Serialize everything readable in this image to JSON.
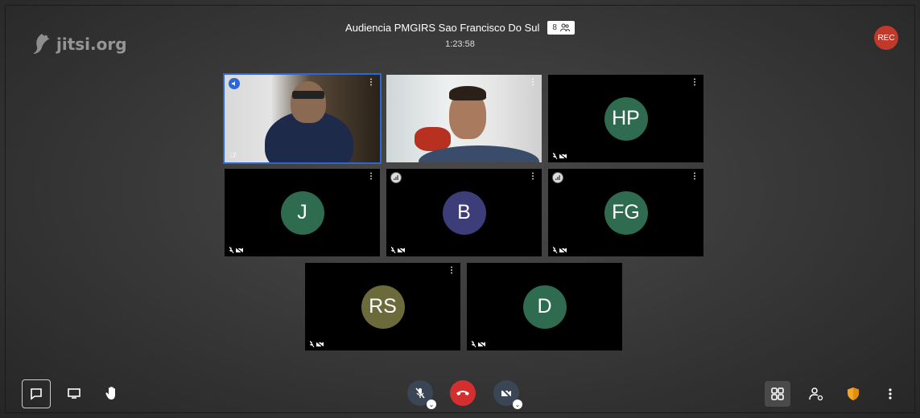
{
  "logo": {
    "text": "jitsi.org"
  },
  "header": {
    "title": "Audiencia PMGIRS Sao Francisco Do Sul",
    "participant_count": "8",
    "duration": "1:23:58"
  },
  "recording": {
    "label": "REC",
    "color": "#c0392b"
  },
  "tiles": [
    {
      "type": "video",
      "name": "speaker-video",
      "active": true
    },
    {
      "type": "video",
      "name": "video-2"
    },
    {
      "type": "avatar",
      "initials": "HP",
      "color": "#2e6b4f"
    },
    {
      "type": "avatar",
      "initials": "J",
      "color": "#2e6b4f"
    },
    {
      "type": "avatar",
      "initials": "B",
      "color": "#3d3d7a"
    },
    {
      "type": "avatar",
      "initials": "FG",
      "color": "#2e6b4f"
    },
    {
      "type": "avatar",
      "initials": "RS",
      "color": "#6a6a3a"
    },
    {
      "type": "avatar",
      "initials": "D",
      "color": "#2e6b4f"
    }
  ],
  "toolbar": {
    "left": [
      "chat-icon",
      "screen-share-icon",
      "raise-hand-icon"
    ],
    "center": [
      "microphone-muted-icon",
      "hangup-icon",
      "camera-muted-icon"
    ],
    "right": [
      "tile-view-icon",
      "invite-icon",
      "security-icon",
      "more-icon"
    ],
    "hangup_color": "#d32f2f",
    "security_color": "#f5a623"
  }
}
